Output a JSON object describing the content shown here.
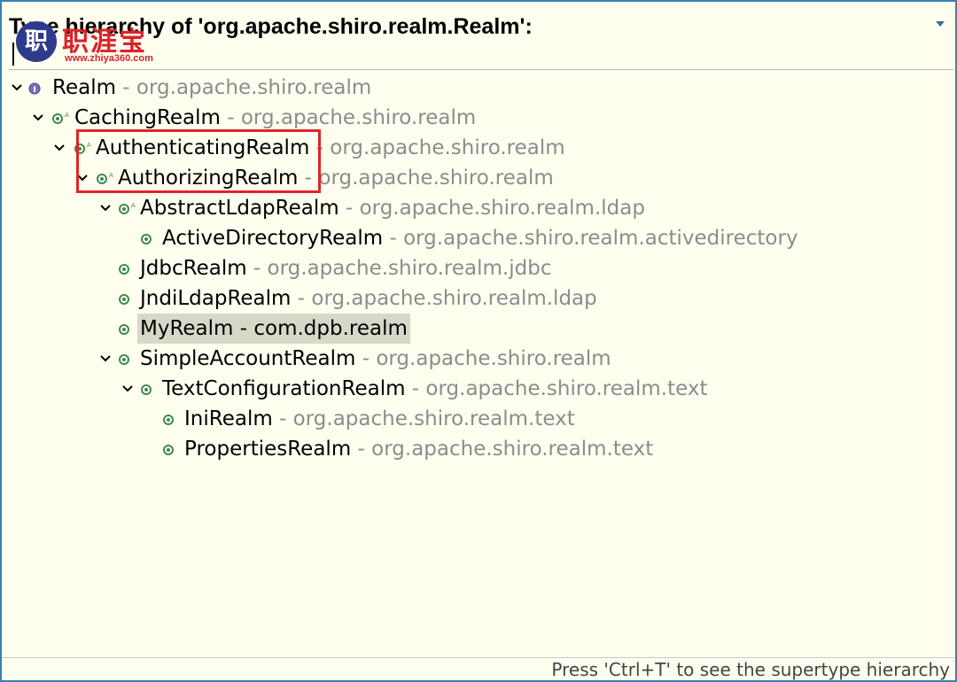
{
  "window": {
    "title": "Type hierarchy of 'org.apache.shiro.realm.Realm':",
    "status_text": "Press 'Ctrl+T' to see the supertype hierarchy"
  },
  "watermark": {
    "logo_glyph": "职",
    "brand": "职涯宝",
    "url": "www.zhiya360.com"
  },
  "colors": {
    "border": "#3c7fb1",
    "background": "#fffff0",
    "package_text": "#8c8c8c",
    "selection": "#d8d8c8",
    "highlight_box": "#e0242b",
    "class_icon": "#3f8c4a"
  },
  "tree": [
    {
      "name": "Realm",
      "separator": " - ",
      "pkg": "org.apache.shiro.realm",
      "icon": "interface-icon",
      "expanded": true
    },
    {
      "name": "CachingRealm",
      "separator": " - ",
      "pkg": "org.apache.shiro.realm",
      "icon": "abstract-class-icon",
      "expanded": true
    },
    {
      "name": "AuthenticatingRealm",
      "separator": " - ",
      "pkg": "org.apache.shiro.realm",
      "icon": "abstract-class-icon",
      "expanded": true
    },
    {
      "name": "AuthorizingRealm",
      "separator": " - ",
      "pkg": "org.apache.shiro.realm",
      "icon": "abstract-class-icon",
      "expanded": true
    },
    {
      "name": "AbstractLdapRealm",
      "separator": " - ",
      "pkg": "org.apache.shiro.realm.ldap",
      "icon": "abstract-class-icon",
      "expanded": true
    },
    {
      "name": "ActiveDirectoryRealm",
      "separator": " - ",
      "pkg": "org.apache.shiro.realm.activedirectory",
      "icon": "class-icon",
      "expanded": false
    },
    {
      "name": "JdbcRealm",
      "separator": " - ",
      "pkg": "org.apache.shiro.realm.jdbc",
      "icon": "class-icon",
      "expanded": false
    },
    {
      "name": "JndiLdapRealm",
      "separator": " - ",
      "pkg": "org.apache.shiro.realm.ldap",
      "icon": "class-icon",
      "expanded": false
    },
    {
      "name": "MyRealm",
      "separator": " - ",
      "pkg": "com.dpb.realm",
      "icon": "class-icon",
      "expanded": false,
      "selected": true
    },
    {
      "name": "SimpleAccountRealm",
      "separator": " - ",
      "pkg": "org.apache.shiro.realm",
      "icon": "class-icon",
      "expanded": true
    },
    {
      "name": "TextConfigurationRealm",
      "separator": " - ",
      "pkg": "org.apache.shiro.realm.text",
      "icon": "class-icon",
      "expanded": true
    },
    {
      "name": "IniRealm",
      "separator": " - ",
      "pkg": "org.apache.shiro.realm.text",
      "icon": "class-icon",
      "expanded": false
    },
    {
      "name": "PropertiesRealm",
      "separator": " - ",
      "pkg": "org.apache.shiro.realm.text",
      "icon": "class-icon",
      "expanded": false
    }
  ]
}
